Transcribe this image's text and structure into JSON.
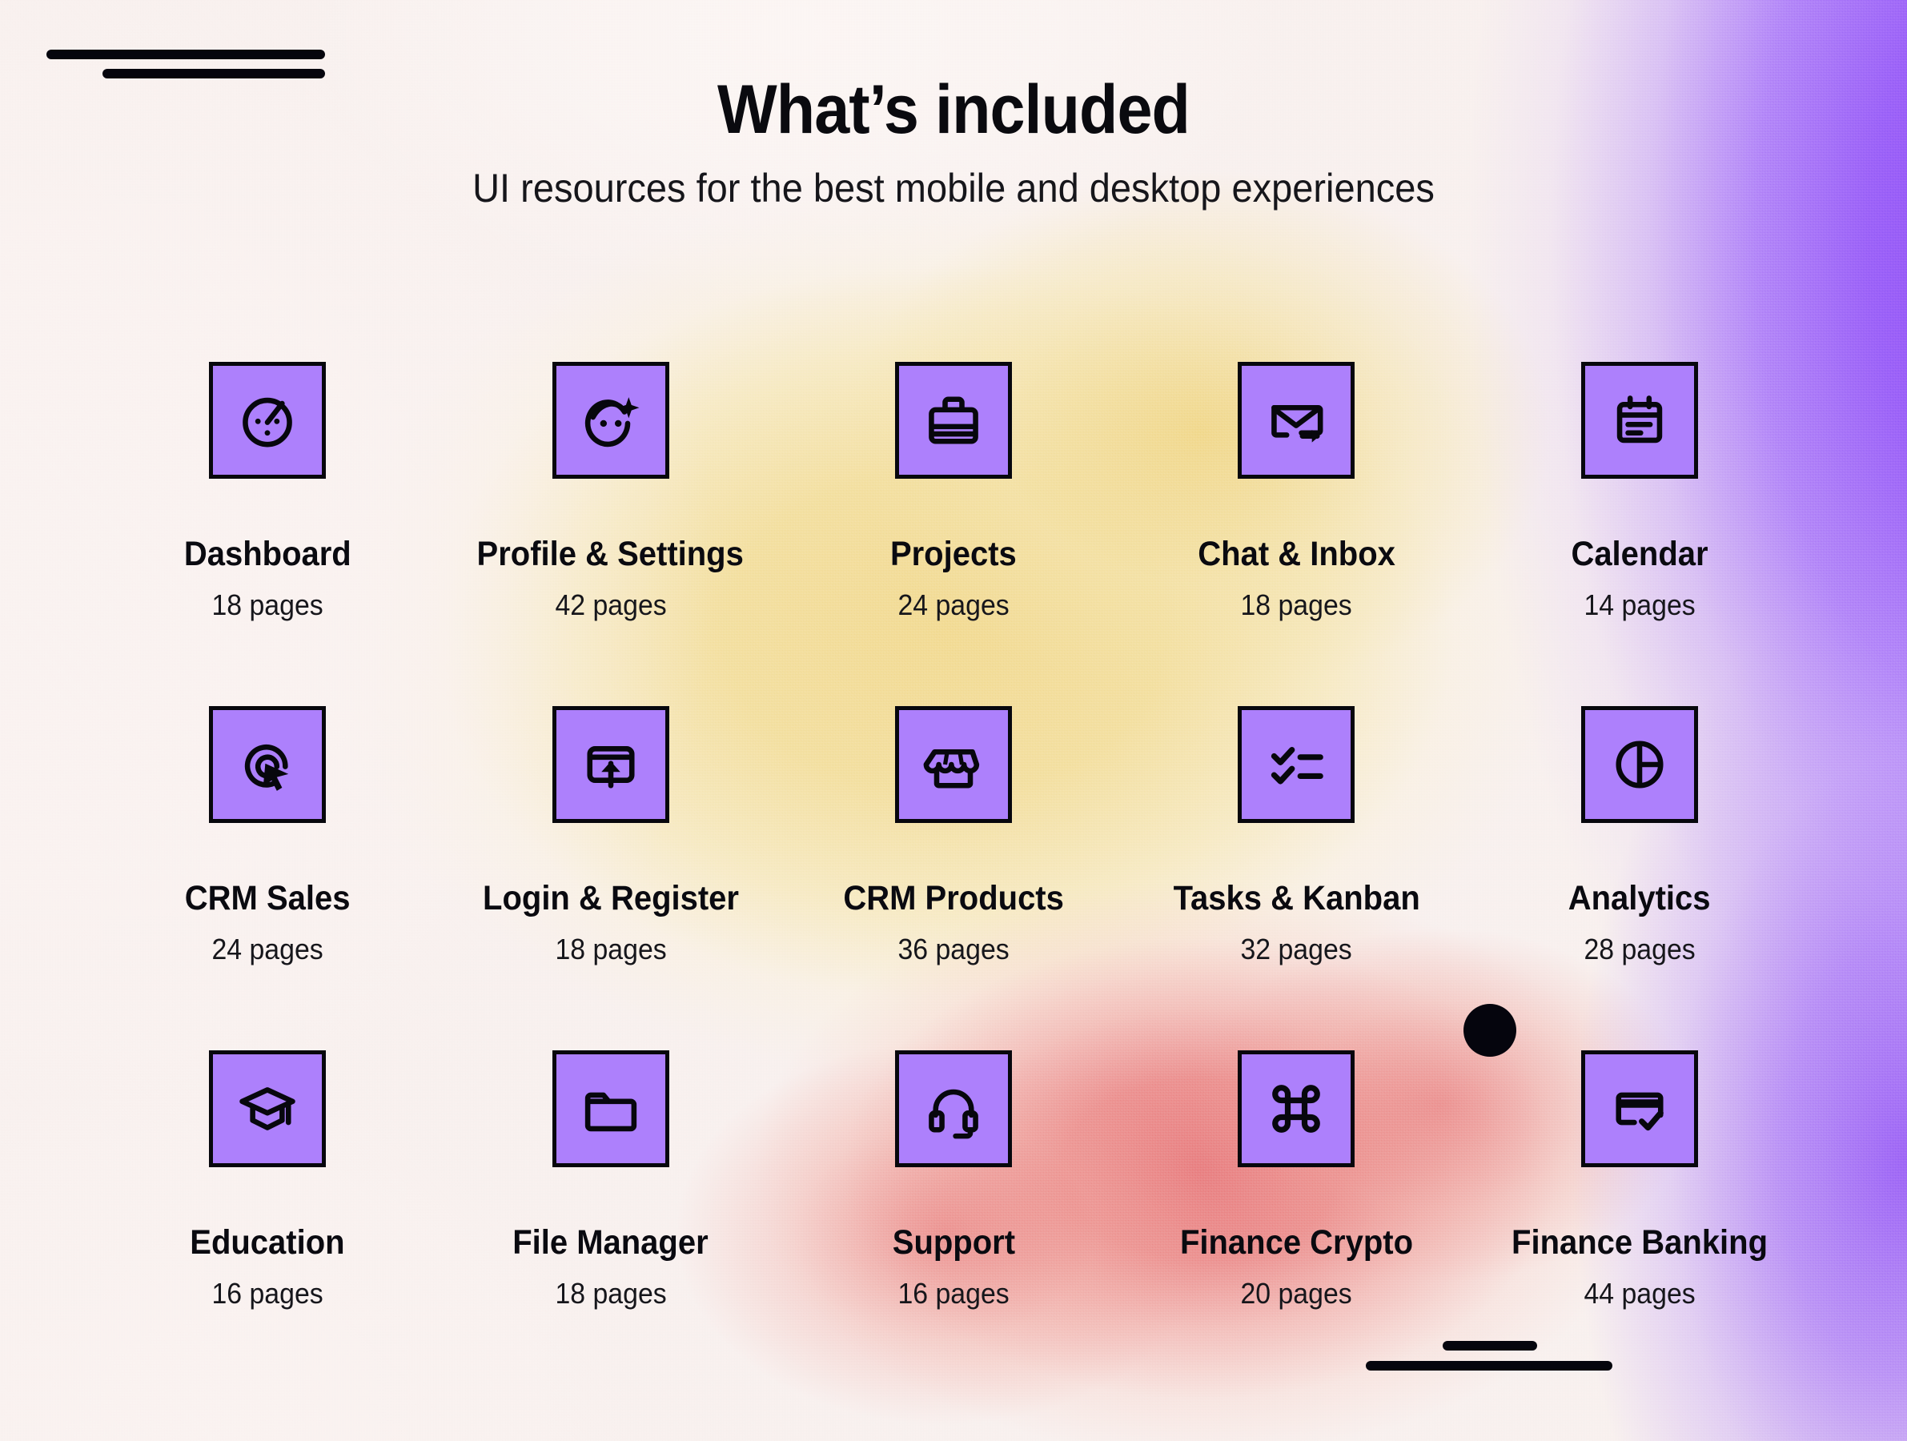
{
  "header": {
    "title": "What’s included",
    "subtitle": "UI resources for the best mobile and desktop experiences"
  },
  "theme": {
    "tile_fill": "#AD80FC",
    "tile_border": "#07070D",
    "ink": "#0A0A10",
    "bg_cream": "#F8F0EE",
    "bg_yellow": "#F0DC91",
    "bg_red": "#E7787A",
    "bg_purple": "#8B4DF6"
  },
  "decorations": {
    "top_left_marks": "double-line-mark",
    "bottom_right_marks": "double-line-mark",
    "dot": "filled-circle"
  },
  "grid": {
    "columns": 5,
    "rows": 3,
    "items": [
      {
        "icon": "gauge-icon",
        "label": "Dashboard",
        "pages": "18 pages"
      },
      {
        "icon": "face-sparkle-icon",
        "label": "Profile & Settings",
        "pages": "42 pages"
      },
      {
        "icon": "briefcase-icon",
        "label": "Projects",
        "pages": "24 pages"
      },
      {
        "icon": "envelope-arrow-icon",
        "label": "Chat & Inbox",
        "pages": "18 pages"
      },
      {
        "icon": "calendar-icon",
        "label": "Calendar",
        "pages": "14 pages"
      },
      {
        "icon": "target-cursor-icon",
        "label": "CRM Sales",
        "pages": "24 pages"
      },
      {
        "icon": "window-upload-icon",
        "label": "Login & Register",
        "pages": "18 pages"
      },
      {
        "icon": "storefront-icon",
        "label": "CRM Products",
        "pages": "36 pages"
      },
      {
        "icon": "checklist-icon",
        "label": "Tasks & Kanban",
        "pages": "32 pages"
      },
      {
        "icon": "pie-chart-icon",
        "label": "Analytics",
        "pages": "28 pages"
      },
      {
        "icon": "graduation-cap-icon",
        "label": "Education",
        "pages": "16 pages"
      },
      {
        "icon": "folder-icon",
        "label": "File Manager",
        "pages": "18 pages"
      },
      {
        "icon": "headset-icon",
        "label": "Support",
        "pages": "16 pages"
      },
      {
        "icon": "command-icon",
        "label": "Finance Crypto",
        "pages": "20 pages"
      },
      {
        "icon": "card-check-icon",
        "label": "Finance Banking",
        "pages": "44 pages"
      }
    ]
  }
}
